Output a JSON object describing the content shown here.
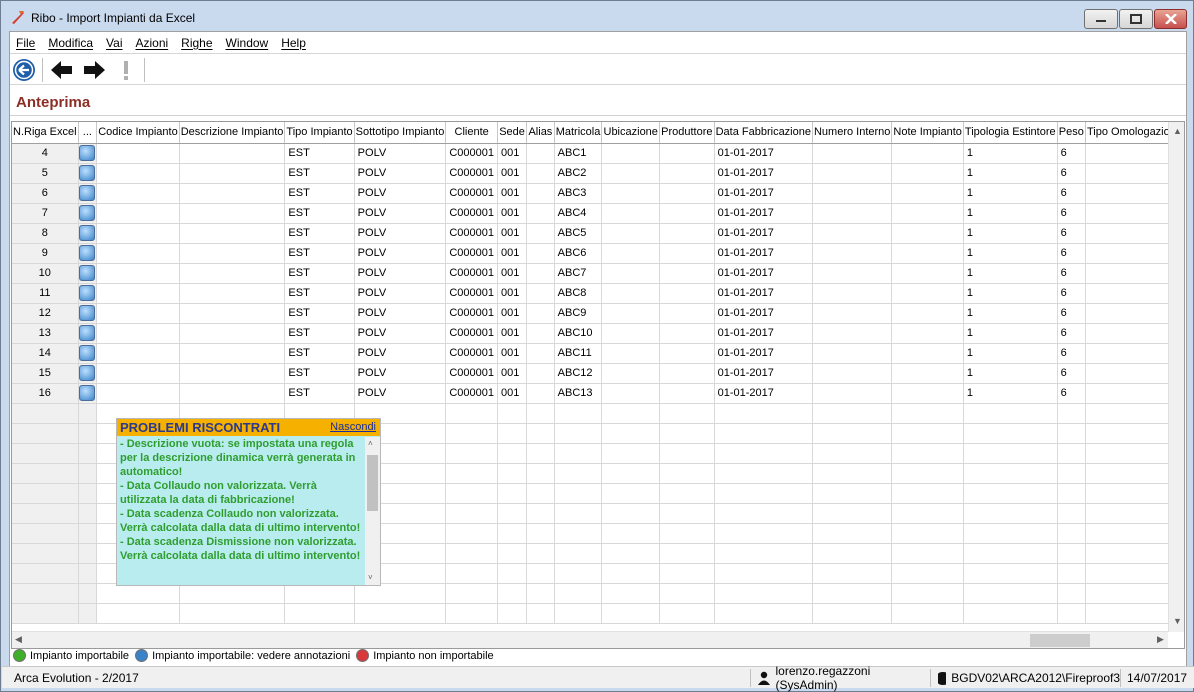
{
  "window": {
    "title": "Ribo - Import Impianti da Excel"
  },
  "menu": [
    "File",
    "Modifica",
    "Vai",
    "Azioni",
    "Righe",
    "Window",
    "Help"
  ],
  "toolbar": {
    "back": "back-circle-icon",
    "prev": "arrow-left-icon",
    "next": "arrow-right-icon",
    "alert": "exclamation-icon"
  },
  "section_title": "Anteprima",
  "grid": {
    "columns": [
      "N.Riga Excel",
      "...",
      "Codice Impianto",
      "Descrizione Impianto",
      "Tipo Impianto",
      "Sottotipo Impianto",
      "Cliente",
      "Sede",
      "Alias",
      "Matricola",
      "Ubicazione",
      "Produttore",
      "Data Fabbricazione",
      "Numero Interno",
      "Note Impianto",
      "Tipologia Estintore",
      "Peso",
      "Tipo Omologazione"
    ],
    "rows": [
      [
        "4",
        "",
        "",
        "",
        "EST",
        "POLV",
        "C000001",
        "001",
        "",
        "ABC1",
        "",
        "",
        "01-01-2017",
        "",
        "",
        "1",
        "6",
        ""
      ],
      [
        "5",
        "",
        "",
        "",
        "EST",
        "POLV",
        "C000001",
        "001",
        "",
        "ABC2",
        "",
        "",
        "01-01-2017",
        "",
        "",
        "1",
        "6",
        ""
      ],
      [
        "6",
        "",
        "",
        "",
        "EST",
        "POLV",
        "C000001",
        "001",
        "",
        "ABC3",
        "",
        "",
        "01-01-2017",
        "",
        "",
        "1",
        "6",
        ""
      ],
      [
        "7",
        "",
        "",
        "",
        "EST",
        "POLV",
        "C000001",
        "001",
        "",
        "ABC4",
        "",
        "",
        "01-01-2017",
        "",
        "",
        "1",
        "6",
        ""
      ],
      [
        "8",
        "",
        "",
        "",
        "EST",
        "POLV",
        "C000001",
        "001",
        "",
        "ABC5",
        "",
        "",
        "01-01-2017",
        "",
        "",
        "1",
        "6",
        ""
      ],
      [
        "9",
        "",
        "",
        "",
        "EST",
        "POLV",
        "C000001",
        "001",
        "",
        "ABC6",
        "",
        "",
        "01-01-2017",
        "",
        "",
        "1",
        "6",
        ""
      ],
      [
        "10",
        "",
        "",
        "",
        "EST",
        "POLV",
        "C000001",
        "001",
        "",
        "ABC7",
        "",
        "",
        "01-01-2017",
        "",
        "",
        "1",
        "6",
        ""
      ],
      [
        "11",
        "",
        "",
        "",
        "EST",
        "POLV",
        "C000001",
        "001",
        "",
        "ABC8",
        "",
        "",
        "01-01-2017",
        "",
        "",
        "1",
        "6",
        ""
      ],
      [
        "12",
        "",
        "",
        "",
        "EST",
        "POLV",
        "C000001",
        "001",
        "",
        "ABC9",
        "",
        "",
        "01-01-2017",
        "",
        "",
        "1",
        "6",
        ""
      ],
      [
        "13",
        "",
        "",
        "",
        "EST",
        "POLV",
        "C000001",
        "001",
        "",
        "ABC10",
        "",
        "",
        "01-01-2017",
        "",
        "",
        "1",
        "6",
        ""
      ],
      [
        "14",
        "",
        "",
        "",
        "EST",
        "POLV",
        "C000001",
        "001",
        "",
        "ABC11",
        "",
        "",
        "01-01-2017",
        "",
        "",
        "1",
        "6",
        ""
      ],
      [
        "15",
        "",
        "",
        "",
        "EST",
        "POLV",
        "C000001",
        "001",
        "",
        "ABC12",
        "",
        "",
        "01-01-2017",
        "",
        "",
        "1",
        "6",
        ""
      ],
      [
        "16",
        "",
        "",
        "",
        "EST",
        "POLV",
        "C000001",
        "001",
        "",
        "ABC13",
        "",
        "",
        "01-01-2017",
        "",
        "",
        "1",
        "6",
        ""
      ]
    ],
    "row_icon": "info-icon"
  },
  "popup": {
    "title": "PROBLEMI RISCONTRATI",
    "hide_label": "Nascondi",
    "messages": [
      " - Descrizione vuota: se impostata una regola per la descrizione dinamica verrà generata in automatico!",
      " - Data Collaudo non valorizzata. Verrà utilizzata la data di fabbricazione!",
      " - Data scadenza Collaudo non valorizzata. Verrà calcolata dalla data di ultimo intervento!",
      " - Data scadenza Dismissione non valorizzata. Verrà calcolata dalla data di ultimo intervento!"
    ]
  },
  "legend": [
    {
      "label": "Impianto importabile",
      "color": "#3fae2a"
    },
    {
      "label": "Impianto importabile: vedere annotazioni",
      "color": "#3a83c9"
    },
    {
      "label": "Impianto non importabile",
      "color": "#d63a3a"
    }
  ],
  "status": {
    "app": "Arca Evolution - 2/2017",
    "user": "lorenzo.regazzoni (SysAdmin)",
    "db": "BGDV02\\ARCA2012\\Fireproof3",
    "date": "14/07/2017"
  }
}
